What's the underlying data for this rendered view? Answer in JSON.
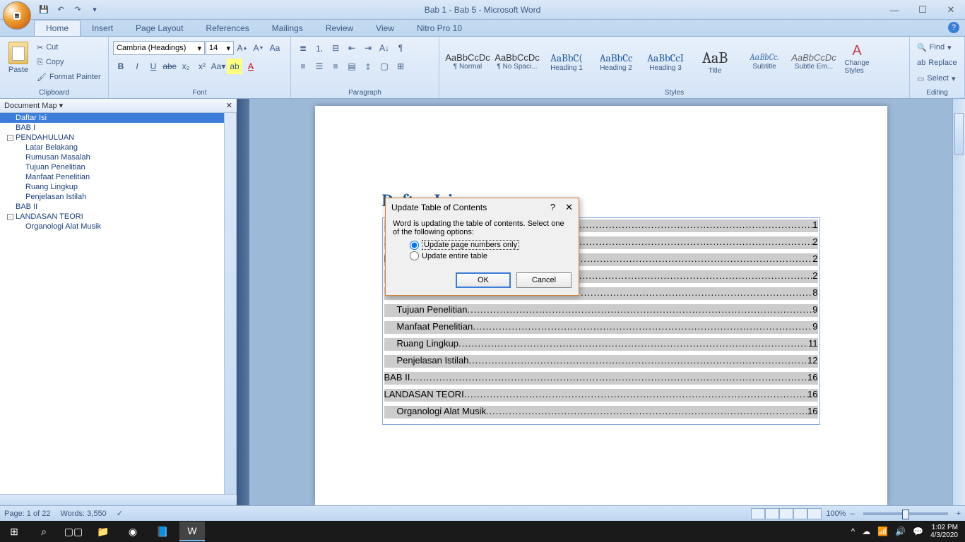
{
  "window": {
    "title": "Bab 1 - Bab 5 - Microsoft Word"
  },
  "tabs": {
    "home": "Home",
    "insert": "Insert",
    "pagelayout": "Page Layout",
    "references": "References",
    "mailings": "Mailings",
    "review": "Review",
    "view": "View",
    "nitro": "Nitro Pro 10"
  },
  "ribbon": {
    "clipboard": {
      "label": "Clipboard",
      "paste": "Paste",
      "cut": "Cut",
      "copy": "Copy",
      "formatpainter": "Format Painter"
    },
    "font": {
      "label": "Font",
      "name": "Cambria (Headings)",
      "size": "14"
    },
    "paragraph": {
      "label": "Paragraph"
    },
    "styles": {
      "label": "Styles",
      "items": [
        {
          "preview": "AaBbCcDc",
          "name": "¶ Normal"
        },
        {
          "preview": "AaBbCcDc",
          "name": "¶ No Spaci..."
        },
        {
          "preview": "AaBbC(",
          "name": "Heading 1"
        },
        {
          "preview": "AaBbCc",
          "name": "Heading 2"
        },
        {
          "preview": "AaBbCcI",
          "name": "Heading 3"
        },
        {
          "preview": "AaB",
          "name": "Title"
        },
        {
          "preview": "AaBbCc.",
          "name": "Subtitle"
        },
        {
          "preview": "AaBbCcDc",
          "name": "Subtle Em..."
        }
      ],
      "change": "Change Styles"
    },
    "editing": {
      "label": "Editing",
      "find": "Find",
      "replace": "Replace",
      "select": "Select"
    }
  },
  "docmap": {
    "title": "Document Map",
    "items": [
      {
        "text": "Daftar Isi",
        "level": 0,
        "selected": true
      },
      {
        "text": "BAB I",
        "level": 0
      },
      {
        "text": "PENDAHULUAN",
        "level": 0,
        "expandable": true
      },
      {
        "text": "Latar Belakang",
        "level": 2
      },
      {
        "text": "Rumusan Masalah",
        "level": 2
      },
      {
        "text": "Tujuan Penelitian",
        "level": 2
      },
      {
        "text": "Manfaat Penelitian",
        "level": 2
      },
      {
        "text": "Ruang Lingkup",
        "level": 2
      },
      {
        "text": "Penjelasan Istilah",
        "level": 2
      },
      {
        "text": "BAB II",
        "level": 0
      },
      {
        "text": "LANDASAN TEORI",
        "level": 0,
        "expandable": true
      },
      {
        "text": "Organologi Alat Musik",
        "level": 2
      }
    ]
  },
  "document": {
    "title": "Daftar Isi",
    "toc": [
      {
        "text": "",
        "page": "1",
        "level": 0
      },
      {
        "text": "",
        "page": "2",
        "level": 0
      },
      {
        "text": "PENDAHULUAN",
        "page": "2",
        "level": 0
      },
      {
        "text": "Latar Belakang",
        "page": "2",
        "level": 1
      },
      {
        "text": "Rumusan Masalah",
        "page": "8",
        "level": 1
      },
      {
        "text": "Tujuan Penelitian",
        "page": "9",
        "level": 1
      },
      {
        "text": "Manfaat Penelitian",
        "page": "9",
        "level": 1
      },
      {
        "text": "Ruang Lingkup",
        "page": "11",
        "level": 1
      },
      {
        "text": "Penjelasan Istilah",
        "page": "12",
        "level": 1
      },
      {
        "text": "BAB II",
        "page": "16",
        "level": 0
      },
      {
        "text": "LANDASAN TEORI",
        "page": "16",
        "level": 0
      },
      {
        "text": "Organologi Alat Musik",
        "page": "16",
        "level": 1
      }
    ]
  },
  "dialog": {
    "title": "Update Table of Contents",
    "message": "Word is updating the table of contents.  Select one of the following options:",
    "opt1": "Update page numbers only",
    "opt2": "Update entire table",
    "ok": "OK",
    "cancel": "Cancel"
  },
  "status": {
    "page": "Page: 1 of 22",
    "words": "Words: 3,550",
    "zoom": "100%"
  },
  "taskbar": {
    "time": "1:02 PM",
    "date": "4/3/2020"
  }
}
